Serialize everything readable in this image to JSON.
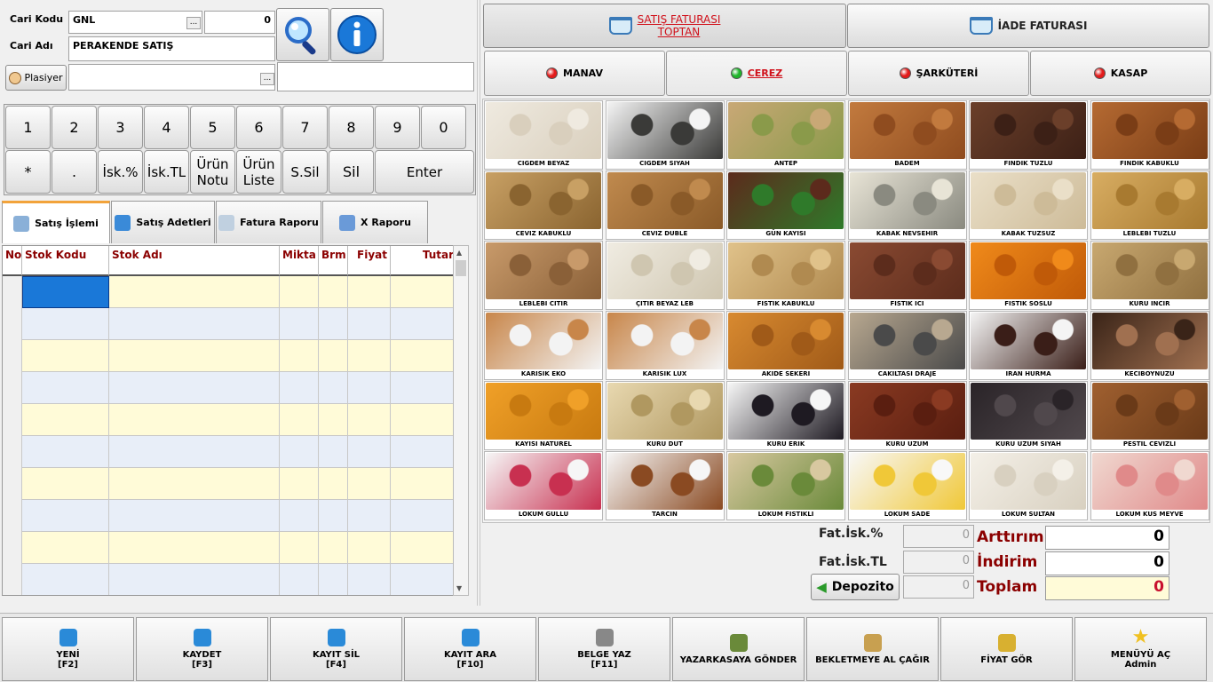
{
  "customer": {
    "code_label": "Cari Kodu",
    "code_value": "GNL",
    "code_number": "0",
    "name_label": "Cari Adı",
    "name_value": "PERAKENDE SATIŞ",
    "plasiyer_label": "Plasiyer",
    "plasiyer_value": "",
    "extra_value": "",
    "dots": "..."
  },
  "keypad": {
    "row1": [
      "1",
      "2",
      "3",
      "4",
      "5",
      "6",
      "7",
      "8",
      "9",
      "0"
    ],
    "row2": [
      "*",
      ".",
      "İsk.%",
      "İsk.TL",
      "Ürün Notu",
      "Ürün Liste",
      "S.Sil",
      "Sil",
      "Enter"
    ]
  },
  "tabs": [
    {
      "label": "Satış İşlemi",
      "icon": "cash-register-icon"
    },
    {
      "label": "Satış Adetleri",
      "icon": "bar-chart-icon"
    },
    {
      "label": "Fatura Raporu",
      "icon": "document-icon"
    },
    {
      "label": "X Raporu",
      "icon": "tools-icon"
    }
  ],
  "grid": {
    "columns": [
      "No",
      "Stok Kodu",
      "Stok Adı",
      "Mikta",
      "Brm",
      "Fiyat",
      "Tutar"
    ],
    "row_count": 10
  },
  "invoice_types": [
    {
      "label": "SATIŞ FATURASI\nTOPTAN",
      "selected": true,
      "icon": "basket-icon"
    },
    {
      "label": "İADE FATURASI",
      "selected": false,
      "icon": "basket-icon"
    }
  ],
  "categories": [
    {
      "label": "MANAV",
      "dot_color": "#e31b1b",
      "selected": false
    },
    {
      "label": "CEREZ",
      "dot_color": "#1fb52b",
      "selected": true
    },
    {
      "label": "ŞARKÜTERİ",
      "dot_color": "#e31b1b",
      "selected": false
    },
    {
      "label": "KASAP",
      "dot_color": "#e31b1b",
      "selected": false
    }
  ],
  "products": [
    {
      "name": "CIGDEM BEYAZ",
      "c1": "#efeae0",
      "c2": "#d9cfbd"
    },
    {
      "name": "CIGDEM SIYAH",
      "c1": "#f4f4f4",
      "c2": "#3a3a38"
    },
    {
      "name": "ANTEP",
      "c1": "#c9a876",
      "c2": "#8a9a4a"
    },
    {
      "name": "BADEM",
      "c1": "#c27a3e",
      "c2": "#8f4c1f"
    },
    {
      "name": "FINDIK TUZLU",
      "c1": "#6b3f2a",
      "c2": "#3c2016"
    },
    {
      "name": "FINDIK KABUKLU",
      "c1": "#b56a32",
      "c2": "#7a3d16"
    },
    {
      "name": "CEVIZ KABUKLU",
      "c1": "#c8a064",
      "c2": "#8a6430"
    },
    {
      "name": "CEVIZ DUBLE",
      "c1": "#c08a4e",
      "c2": "#8a5a28"
    },
    {
      "name": "GÜN KAYISI",
      "c1": "#5c2a1c",
      "c2": "#2f7a2a"
    },
    {
      "name": "KABAK NEVSEHIR",
      "c1": "#e8e4d6",
      "c2": "#8a8a80"
    },
    {
      "name": "KABAK TUZSUZ",
      "c1": "#eadfc8",
      "c2": "#cdbb98"
    },
    {
      "name": "LEBLEBI TUZLU",
      "c1": "#d8ad62",
      "c2": "#a87a30"
    },
    {
      "name": "LEBLEBI CITIR",
      "c1": "#c89a6a",
      "c2": "#8a6038"
    },
    {
      "name": "ÇITIR BEYAZ LEB",
      "c1": "#f0ece2",
      "c2": "#cfc6b0"
    },
    {
      "name": "FISTIK KABUKLU",
      "c1": "#e0c28a",
      "c2": "#b08a50"
    },
    {
      "name": "FISTIK ICI",
      "c1": "#8a4a32",
      "c2": "#5c2c1c"
    },
    {
      "name": "FISTIK SOSLU",
      "c1": "#f08a1a",
      "c2": "#c05a08"
    },
    {
      "name": "KURU INCIR",
      "c1": "#c8a870",
      "c2": "#907040"
    },
    {
      "name": "KARISIK EKO",
      "c1": "#c8864a",
      "c2": "#f3f3f3"
    },
    {
      "name": "KARISIK LUX",
      "c1": "#c8864a",
      "c2": "#f3f3f3"
    },
    {
      "name": "AKIDE SEKERI",
      "c1": "#d88a30",
      "c2": "#a05a18"
    },
    {
      "name": "CAKILTASI DRAJE",
      "c1": "#b8a890",
      "c2": "#4a4a4a"
    },
    {
      "name": "IRAN HURMA",
      "c1": "#f4f4f4",
      "c2": "#3a1e18"
    },
    {
      "name": "KECIBOYNUZU",
      "c1": "#3a2418",
      "c2": "#a07050"
    },
    {
      "name": "KAYISI NATUREL",
      "c1": "#f0a028",
      "c2": "#c87a10"
    },
    {
      "name": "KURU DUT",
      "c1": "#e8d8b0",
      "c2": "#b09860"
    },
    {
      "name": "KURU ERIK",
      "c1": "#f6f6f6",
      "c2": "#1e1a22"
    },
    {
      "name": "KURU UZUM",
      "c1": "#8a3a22",
      "c2": "#5a1e10"
    },
    {
      "name": "KURU UZUM SIYAH",
      "c1": "#2a2428",
      "c2": "#50484c"
    },
    {
      "name": "PESTIL CEVIZLI",
      "c1": "#a06030",
      "c2": "#6a3a18"
    },
    {
      "name": "LOKUM GULLU",
      "c1": "#f6f6f6",
      "c2": "#c83050"
    },
    {
      "name": "TARCIN",
      "c1": "#f6f6f6",
      "c2": "#8a4a22"
    },
    {
      "name": "LOKUM FISTIKLI",
      "c1": "#d8c8a0",
      "c2": "#6a8a3a"
    },
    {
      "name": "LOKUM SADE",
      "c1": "#f8f8f8",
      "c2": "#f0c838"
    },
    {
      "name": "LOKUM SULTAN",
      "c1": "#f4f0e8",
      "c2": "#d8d0c0"
    },
    {
      "name": "LOKUM KUS MEYVE",
      "c1": "#f0d8d0",
      "c2": "#e08a8a"
    }
  ],
  "summary": {
    "fat_isk_pct_label": "Fat.İsk.%",
    "fat_isk_pct_value": "0",
    "fat_isk_tl_label": "Fat.İsk.TL",
    "fat_isk_tl_value": "0",
    "depozito_label": "Depozito",
    "depozito_value": "0",
    "arttirim_label": "Arttırım",
    "arttirim_value": "0",
    "indirim_label": "İndirim",
    "indirim_value": "0",
    "toplam_label": "Toplam",
    "toplam_value": "0"
  },
  "footer": [
    {
      "label": "YENİ",
      "sub": "[F2]",
      "icon": "new-document-icon",
      "color": "#2a8ad8"
    },
    {
      "label": "KAYDET",
      "sub": "[F3]",
      "icon": "save-icon",
      "color": "#2a8ad8"
    },
    {
      "label": "KAYIT SİL",
      "sub": "[F4]",
      "icon": "trash-icon",
      "color": "#2a8ad8"
    },
    {
      "label": "KAYIT ARA",
      "sub": "[F10]",
      "icon": "search-icon",
      "color": "#2a8ad8"
    },
    {
      "label": "BELGE YAZ",
      "sub": "[F11]",
      "icon": "printer-icon",
      "color": "#888888"
    },
    {
      "label": "YAZARKASAYA GÖNDER",
      "sub": "",
      "icon": "cash-register-icon",
      "color": "#6a8a3a"
    },
    {
      "label": "BEKLETMEYE AL ÇAĞIR",
      "sub": "",
      "icon": "paperclip-icon",
      "color": "#c8a050"
    },
    {
      "label": "FİYAT GÖR",
      "sub": "",
      "icon": "price-tag-icon",
      "color": "#d8b030"
    },
    {
      "label": "MENÜYÜ AÇ",
      "sub": "Admin",
      "icon": "star-icon",
      "color": "#f0c020"
    }
  ]
}
